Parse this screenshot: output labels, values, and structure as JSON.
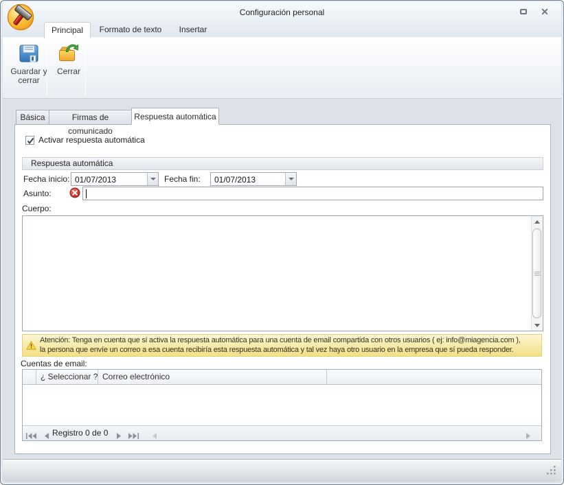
{
  "window": {
    "title": "Configuración personal",
    "icons": {
      "app": "hammer-icon",
      "minimize": "restore-box-icon",
      "close": "x-icon"
    }
  },
  "ribbon": {
    "tabs": [
      {
        "label": "Principal",
        "active": true
      },
      {
        "label": "Formato de texto",
        "active": false
      },
      {
        "label": "Insertar",
        "active": false
      }
    ],
    "buttons": [
      {
        "label": "Guardar y cerrar",
        "icon": "save-floppy-icon"
      },
      {
        "label": "Cerrar",
        "icon": "folder-green-arrow-icon"
      }
    ]
  },
  "page_tabs": [
    {
      "label": "Básica",
      "active": false
    },
    {
      "label": "Firmas de comunicado",
      "active": false
    },
    {
      "label": "Respuesta automática",
      "active": true
    }
  ],
  "form": {
    "activate": {
      "label": "Activar respuesta automática",
      "checked": true
    },
    "group_title": "Respuesta automática",
    "fecha_inicio": {
      "label": "Fecha inicio:",
      "value": "01/07/2013"
    },
    "fecha_fin": {
      "label": "Fecha fin:",
      "value": "01/07/2013"
    },
    "asunto": {
      "label": "Asunto:",
      "value": "",
      "error": true
    },
    "cuerpo": {
      "label": "Cuerpo:",
      "value": ""
    }
  },
  "warning": {
    "line1": "Atención: Tenga en cuenta que si activa la respuesta automática para una cuenta de email compartida con otros usuarios ( ej:  info@miagencia.com ),",
    "line2": "la persona que envíe un correo a esa cuenta recibiría esta respuesta automática y tal vez haya otro usuario en la empresa que sí pueda responder."
  },
  "accounts": {
    "label": "Cuentas de email:",
    "columns": [
      "",
      "¿ Seleccionar ?",
      "Correo electrónico",
      ""
    ],
    "rows": [],
    "pager": {
      "status": "Registro 0 de 0"
    }
  },
  "colors": {
    "warning_bg": "#f6e48d",
    "error_red": "#cf2a1b",
    "folder_yellow": "#f5b73d",
    "arrow_green": "#3aa436",
    "floppy_blue": "#4a90d9",
    "chrome": "#dce2e8"
  }
}
